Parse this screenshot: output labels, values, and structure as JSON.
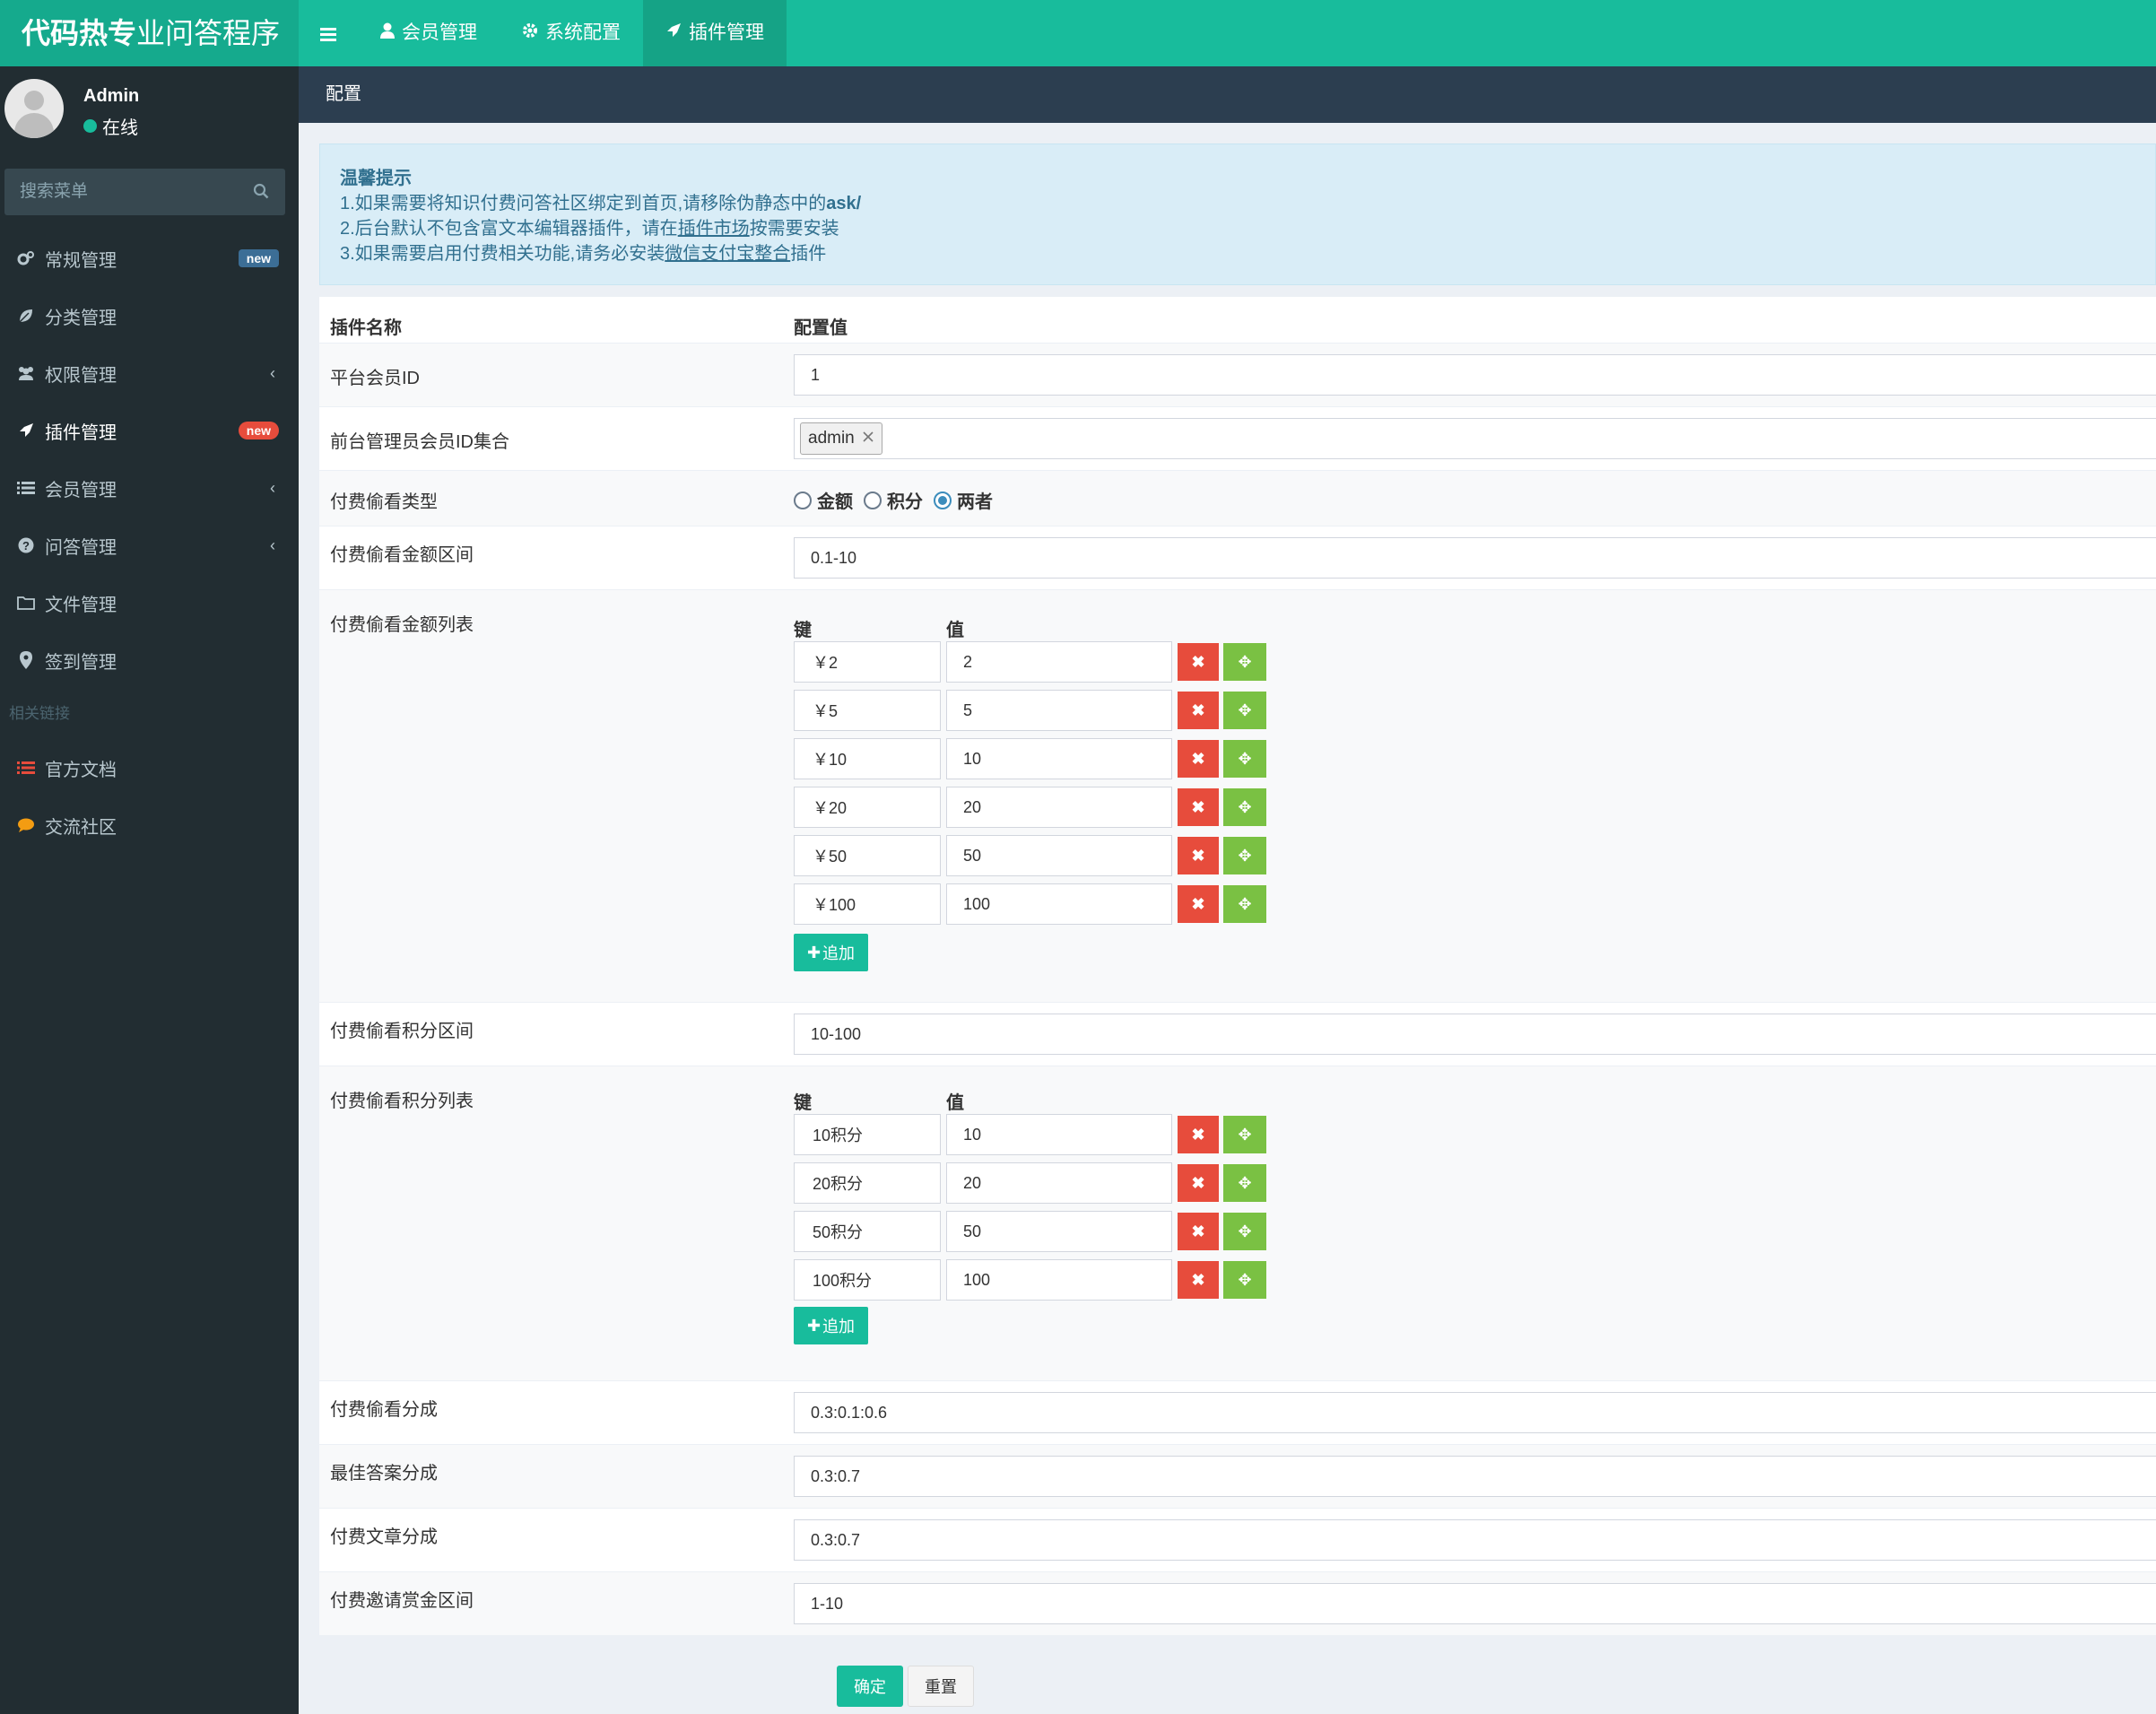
{
  "app": {
    "logo_bold": "代码热专",
    "logo_rest": "业问答程序"
  },
  "topnav": {
    "items": [
      {
        "label": "会员管理",
        "icon": "user-icon"
      },
      {
        "label": "系统配置",
        "icon": "gear-icon"
      },
      {
        "label": "插件管理",
        "icon": "rocket-icon"
      }
    ]
  },
  "user": {
    "name": "Admin",
    "status": "在线"
  },
  "search": {
    "placeholder": "搜索菜单"
  },
  "sidebar": {
    "items": [
      {
        "label": "常规管理",
        "icon": "cogs-icon",
        "badge": "new"
      },
      {
        "label": "分类管理",
        "icon": "leaf-icon"
      },
      {
        "label": "权限管理",
        "icon": "users-icon"
      },
      {
        "label": "插件管理",
        "icon": "rocket-icon",
        "badge": "new"
      },
      {
        "label": "会员管理",
        "icon": "list-icon"
      },
      {
        "label": "问答管理",
        "icon": "question-icon"
      },
      {
        "label": "文件管理",
        "icon": "folder-icon"
      },
      {
        "label": "签到管理",
        "icon": "map-marker-icon"
      }
    ],
    "links_header": "相关链接",
    "links": [
      {
        "label": "官方文档",
        "icon": "list-icon",
        "color": "#e74c3c"
      },
      {
        "label": "交流社区",
        "icon": "comment-icon",
        "color": "#f39c12"
      }
    ]
  },
  "content_header": {
    "title": "配置"
  },
  "tips": {
    "title": "温馨提示",
    "line1_text": "1.如果需要将知识付费问答社区绑定到首页,请移除伪静态中的",
    "line1_code": "ask/",
    "line2_a": "2.后台默认不包含富文本编辑器插件，请在",
    "line2_link": "插件市场",
    "line2_b": "按需要安装",
    "line3_a": "3.如果需要启用付费相关功能,请务必安装",
    "line3_link": "微信支付宝整合",
    "line3_b": "插件"
  },
  "table": {
    "col_name": "插件名称",
    "col_value": "配置值"
  },
  "fields": {
    "platform_member_id": {
      "label": "平台会员ID",
      "value": "1"
    },
    "admin_ids": {
      "label": "前台管理员会员ID集合",
      "tag": "admin"
    },
    "peek_type": {
      "label": "付费偷看类型",
      "options": [
        "金额",
        "积分",
        "两者"
      ],
      "selected": "两者"
    },
    "peek_money_range": {
      "label": "付费偷看金额区间",
      "value": "0.1-10"
    },
    "peek_money_list": {
      "label": "付费偷看金额列表",
      "key_header": "键",
      "value_header": "值",
      "rows": [
        {
          "key": "￥2",
          "value": "2"
        },
        {
          "key": "￥5",
          "value": "5"
        },
        {
          "key": "￥10",
          "value": "10"
        },
        {
          "key": "￥20",
          "value": "20"
        },
        {
          "key": "￥50",
          "value": "50"
        },
        {
          "key": "￥100",
          "value": "100"
        }
      ],
      "add_label": "追加"
    },
    "peek_score_range": {
      "label": "付费偷看积分区间",
      "value": "10-100"
    },
    "peek_score_list": {
      "label": "付费偷看积分列表",
      "key_header": "键",
      "value_header": "值",
      "rows": [
        {
          "key": "10积分",
          "value": "10"
        },
        {
          "key": "20积分",
          "value": "20"
        },
        {
          "key": "50积分",
          "value": "50"
        },
        {
          "key": "100积分",
          "value": "100"
        }
      ],
      "add_label": "追加"
    },
    "peek_split": {
      "label": "付费偷看分成",
      "value": "0.3:0.1:0.6"
    },
    "best_answer_split": {
      "label": "最佳答案分成",
      "value": "0.3:0.7"
    },
    "paid_article_split": {
      "label": "付费文章分成",
      "value": "0.3:0.7"
    },
    "invite_reward_range": {
      "label": "付费邀请赏金区间",
      "value": "1-10"
    }
  },
  "actions": {
    "ok": "确定",
    "reset": "重置"
  },
  "colors": {
    "primary": "#18bc9c",
    "sidebar": "#222d32",
    "danger": "#e74c3c",
    "success": "#7ac143",
    "header": "#2c3e50"
  }
}
